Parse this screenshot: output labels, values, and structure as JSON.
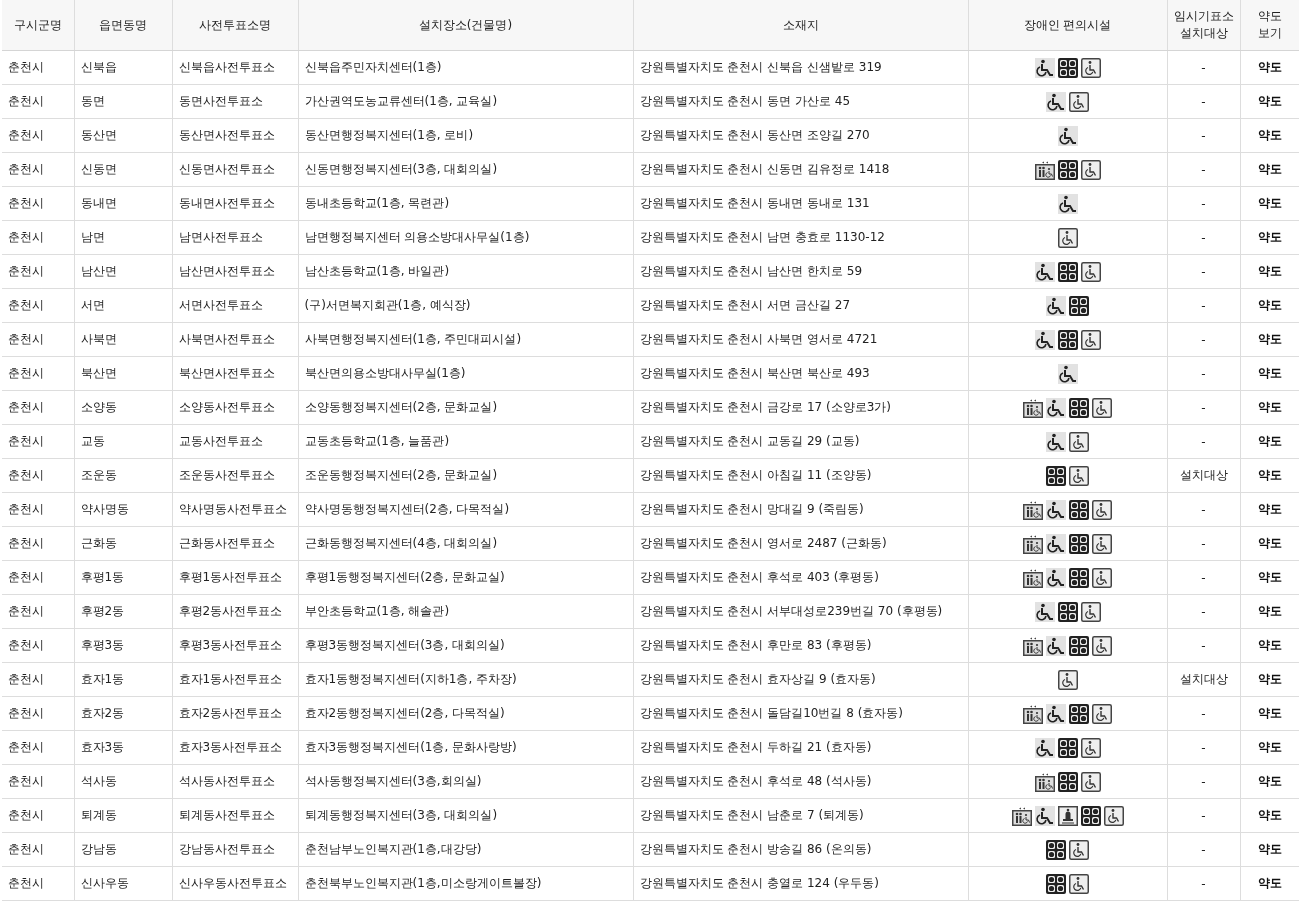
{
  "table": {
    "columns": [
      "구시군명",
      "읍면동명",
      "사전투표소명",
      "설치장소(건물명)",
      "소재지",
      "장애인 편의시설",
      "임시기표소\n설치대상",
      "약도\n보기"
    ],
    "rows": [
      {
        "city": "춘천시",
        "district": "신북읍",
        "station": "신북읍사전투표소",
        "place": "신북읍주민자치센터(1층)",
        "address": "강원특별자치도 춘천시 신북읍 신샘밭로 319",
        "facilities": [
          {
            "kind": "ramp"
          },
          {
            "kind": "braille"
          },
          {
            "kind": "wheelchair"
          }
        ],
        "booth": "-",
        "map": "약도"
      },
      {
        "city": "춘천시",
        "district": "동면",
        "station": "동면사전투표소",
        "place": "가산권역도농교류센터(1층, 교육실)",
        "address": "강원특별자치도 춘천시 동면 가산로 45",
        "facilities": [
          {
            "kind": "ramp"
          },
          {
            "kind": "wheelchair"
          }
        ],
        "booth": "-",
        "map": "약도"
      },
      {
        "city": "춘천시",
        "district": "동산면",
        "station": "동산면사전투표소",
        "place": "동산면행정복지센터(1층, 로비)",
        "address": "강원특별자치도 춘천시 동산면 조양길 270",
        "facilities": [
          {
            "kind": "ramp"
          }
        ],
        "booth": "-",
        "map": "약도"
      },
      {
        "city": "춘천시",
        "district": "신동면",
        "station": "신동면사전투표소",
        "place": "신동면행정복지센터(3층, 대회의실)",
        "address": "강원특별자치도 춘천시 신동면 김유정로 1418",
        "facilities": [
          {
            "kind": "toilet"
          },
          {
            "kind": "braille"
          },
          {
            "kind": "wheelchair"
          }
        ],
        "booth": "-",
        "map": "약도"
      },
      {
        "city": "춘천시",
        "district": "동내면",
        "station": "동내면사전투표소",
        "place": "동내초등학교(1층, 목련관)",
        "address": "강원특별자치도 춘천시 동내면 동내로 131",
        "facilities": [
          {
            "kind": "ramp"
          }
        ],
        "booth": "-",
        "map": "약도"
      },
      {
        "city": "춘천시",
        "district": "남면",
        "station": "남면사전투표소",
        "place": "남면행정복지센터 의용소방대사무실(1층)",
        "address": "강원특별자치도 춘천시 남면 충효로 1130-12",
        "facilities": [
          {
            "kind": "wheelchair"
          }
        ],
        "booth": "-",
        "map": "약도"
      },
      {
        "city": "춘천시",
        "district": "남산면",
        "station": "남산면사전투표소",
        "place": "남산초등학교(1층, 바일관)",
        "address": "강원특별자치도 춘천시 남산면 한치로 59",
        "facilities": [
          {
            "kind": "ramp"
          },
          {
            "kind": "braille"
          },
          {
            "kind": "wheelchair"
          }
        ],
        "booth": "-",
        "map": "약도"
      },
      {
        "city": "춘천시",
        "district": "서면",
        "station": "서면사전투표소",
        "place": "(구)서면복지회관(1층, 예식장)",
        "address": "강원특별자치도 춘천시 서면 금산길 27",
        "facilities": [
          {
            "kind": "ramp"
          },
          {
            "kind": "braille"
          }
        ],
        "booth": "-",
        "map": "약도"
      },
      {
        "city": "춘천시",
        "district": "사북면",
        "station": "사북면사전투표소",
        "place": "사북면행정복지센터(1층, 주민대피시설)",
        "address": "강원특별자치도 춘천시 사북면 영서로 4721",
        "facilities": [
          {
            "kind": "ramp"
          },
          {
            "kind": "braille"
          },
          {
            "kind": "wheelchair"
          }
        ],
        "booth": "-",
        "map": "약도"
      },
      {
        "city": "춘천시",
        "district": "북산면",
        "station": "북산면사전투표소",
        "place": "북산면의용소방대사무실(1층)",
        "address": "강원특별자치도 춘천시 북산면 북산로 493",
        "facilities": [
          {
            "kind": "ramp"
          }
        ],
        "booth": "-",
        "map": "약도"
      },
      {
        "city": "춘천시",
        "district": "소양동",
        "station": "소양동사전투표소",
        "place": "소양동행정복지센터(2층, 문화교실)",
        "address": "강원특별자치도 춘천시 금강로 17 (소양로3가)",
        "facilities": [
          {
            "kind": "toilet"
          },
          {
            "kind": "ramp"
          },
          {
            "kind": "braille"
          },
          {
            "kind": "wheelchair"
          }
        ],
        "booth": "-",
        "map": "약도"
      },
      {
        "city": "춘천시",
        "district": "교동",
        "station": "교동사전투표소",
        "place": "교동초등학교(1층, 늘품관)",
        "address": "강원특별자치도 춘천시 교동길 29 (교동)",
        "facilities": [
          {
            "kind": "ramp"
          },
          {
            "kind": "wheelchair"
          }
        ],
        "booth": "-",
        "map": "약도"
      },
      {
        "city": "춘천시",
        "district": "조운동",
        "station": "조운동사전투표소",
        "place": "조운동행정복지센터(2층, 문화교실)",
        "address": "강원특별자치도 춘천시 아침길 11 (조양동)",
        "facilities": [
          {
            "kind": "braille"
          },
          {
            "kind": "wheelchair"
          }
        ],
        "booth": "설치대상",
        "map": "약도"
      },
      {
        "city": "춘천시",
        "district": "약사명동",
        "station": "약사명동사전투표소",
        "place": "약사명동행정복지센터(2층, 다목적실)",
        "address": "강원특별자치도 춘천시 망대길 9 (죽림동)",
        "facilities": [
          {
            "kind": "toilet"
          },
          {
            "kind": "ramp"
          },
          {
            "kind": "braille"
          },
          {
            "kind": "wheelchair"
          }
        ],
        "booth": "-",
        "map": "약도"
      },
      {
        "city": "춘천시",
        "district": "근화동",
        "station": "근화동사전투표소",
        "place": "근화동행정복지센터(4층, 대회의실)",
        "address": "강원특별자치도 춘천시 영서로 2487 (근화동)",
        "facilities": [
          {
            "kind": "toilet"
          },
          {
            "kind": "ramp"
          },
          {
            "kind": "braille"
          },
          {
            "kind": "wheelchair"
          }
        ],
        "booth": "-",
        "map": "약도"
      },
      {
        "city": "춘천시",
        "district": "후평1동",
        "station": "후평1동사전투표소",
        "place": "후평1동행정복지센터(2층, 문화교실)",
        "address": "강원특별자치도 춘천시 후석로 403 (후평동)",
        "facilities": [
          {
            "kind": "toilet"
          },
          {
            "kind": "ramp"
          },
          {
            "kind": "braille"
          },
          {
            "kind": "wheelchair"
          }
        ],
        "booth": "-",
        "map": "약도"
      },
      {
        "city": "춘천시",
        "district": "후평2동",
        "station": "후평2동사전투표소",
        "place": "부안초등학교(1층, 해솔관)",
        "address": "강원특별자치도 춘천시 서부대성로239번길 70 (후평동)",
        "facilities": [
          {
            "kind": "ramp"
          },
          {
            "kind": "braille"
          },
          {
            "kind": "wheelchair"
          }
        ],
        "booth": "-",
        "map": "약도"
      },
      {
        "city": "춘천시",
        "district": "후평3동",
        "station": "후평3동사전투표소",
        "place": "후평3동행정복지센터(3층, 대회의실)",
        "address": "강원특별자치도 춘천시 후만로 83 (후평동)",
        "facilities": [
          {
            "kind": "toilet"
          },
          {
            "kind": "ramp"
          },
          {
            "kind": "braille"
          },
          {
            "kind": "wheelchair"
          }
        ],
        "booth": "-",
        "map": "약도"
      },
      {
        "city": "춘천시",
        "district": "효자1동",
        "station": "효자1동사전투표소",
        "place": "효자1동행정복지센터(지하1층, 주차장)",
        "address": "강원특별자치도 춘천시 효자상길 9 (효자동)",
        "facilities": [
          {
            "kind": "wheelchair"
          }
        ],
        "booth": "설치대상",
        "map": "약도"
      },
      {
        "city": "춘천시",
        "district": "효자2동",
        "station": "효자2동사전투표소",
        "place": "효자2동행정복지센터(2층, 다목적실)",
        "address": "강원특별자치도 춘천시 돌담길10번길 8 (효자동)",
        "facilities": [
          {
            "kind": "toilet"
          },
          {
            "kind": "ramp"
          },
          {
            "kind": "braille"
          },
          {
            "kind": "wheelchair"
          }
        ],
        "booth": "-",
        "map": "약도"
      },
      {
        "city": "춘천시",
        "district": "효자3동",
        "station": "효자3동사전투표소",
        "place": "효자3동행정복지센터(1층, 문화사랑방)",
        "address": "강원특별자치도 춘천시 두하길 21 (효자동)",
        "facilities": [
          {
            "kind": "ramp"
          },
          {
            "kind": "braille"
          },
          {
            "kind": "wheelchair"
          }
        ],
        "booth": "-",
        "map": "약도"
      },
      {
        "city": "춘천시",
        "district": "석사동",
        "station": "석사동사전투표소",
        "place": "석사동행정복지센터(3층,회의실)",
        "address": "강원특별자치도 춘천시 후석로 48 (석사동)",
        "facilities": [
          {
            "kind": "toilet"
          },
          {
            "kind": "braille"
          },
          {
            "kind": "wheelchair"
          }
        ],
        "booth": "-",
        "map": "약도"
      },
      {
        "city": "춘천시",
        "district": "퇴계동",
        "station": "퇴계동사전투표소",
        "place": "퇴계동행정복지센터(3층, 대회의실)",
        "address": "강원특별자치도 춘천시 남춘로 7 (퇴계동)",
        "facilities": [
          {
            "kind": "toilet"
          },
          {
            "kind": "ramp"
          },
          {
            "kind": "bell"
          },
          {
            "kind": "braille"
          },
          {
            "kind": "wheelchair"
          }
        ],
        "booth": "-",
        "map": "약도"
      },
      {
        "city": "춘천시",
        "district": "강남동",
        "station": "강남동사전투표소",
        "place": "춘천남부노인복지관(1층,대강당)",
        "address": "강원특별자치도 춘천시 방송길 86 (온의동)",
        "facilities": [
          {
            "kind": "braille"
          },
          {
            "kind": "wheelchair"
          }
        ],
        "booth": "-",
        "map": "약도"
      },
      {
        "city": "춘천시",
        "district": "신사우동",
        "station": "신사우동사전투표소",
        "place": "춘천북부노인복지관(1층,미소랑게이트볼장)",
        "address": "강원특별자치도 춘천시 충열로 124 (우두동)",
        "facilities": [
          {
            "kind": "braille"
          },
          {
            "kind": "wheelchair"
          }
        ],
        "booth": "-",
        "map": "약도"
      }
    ]
  }
}
